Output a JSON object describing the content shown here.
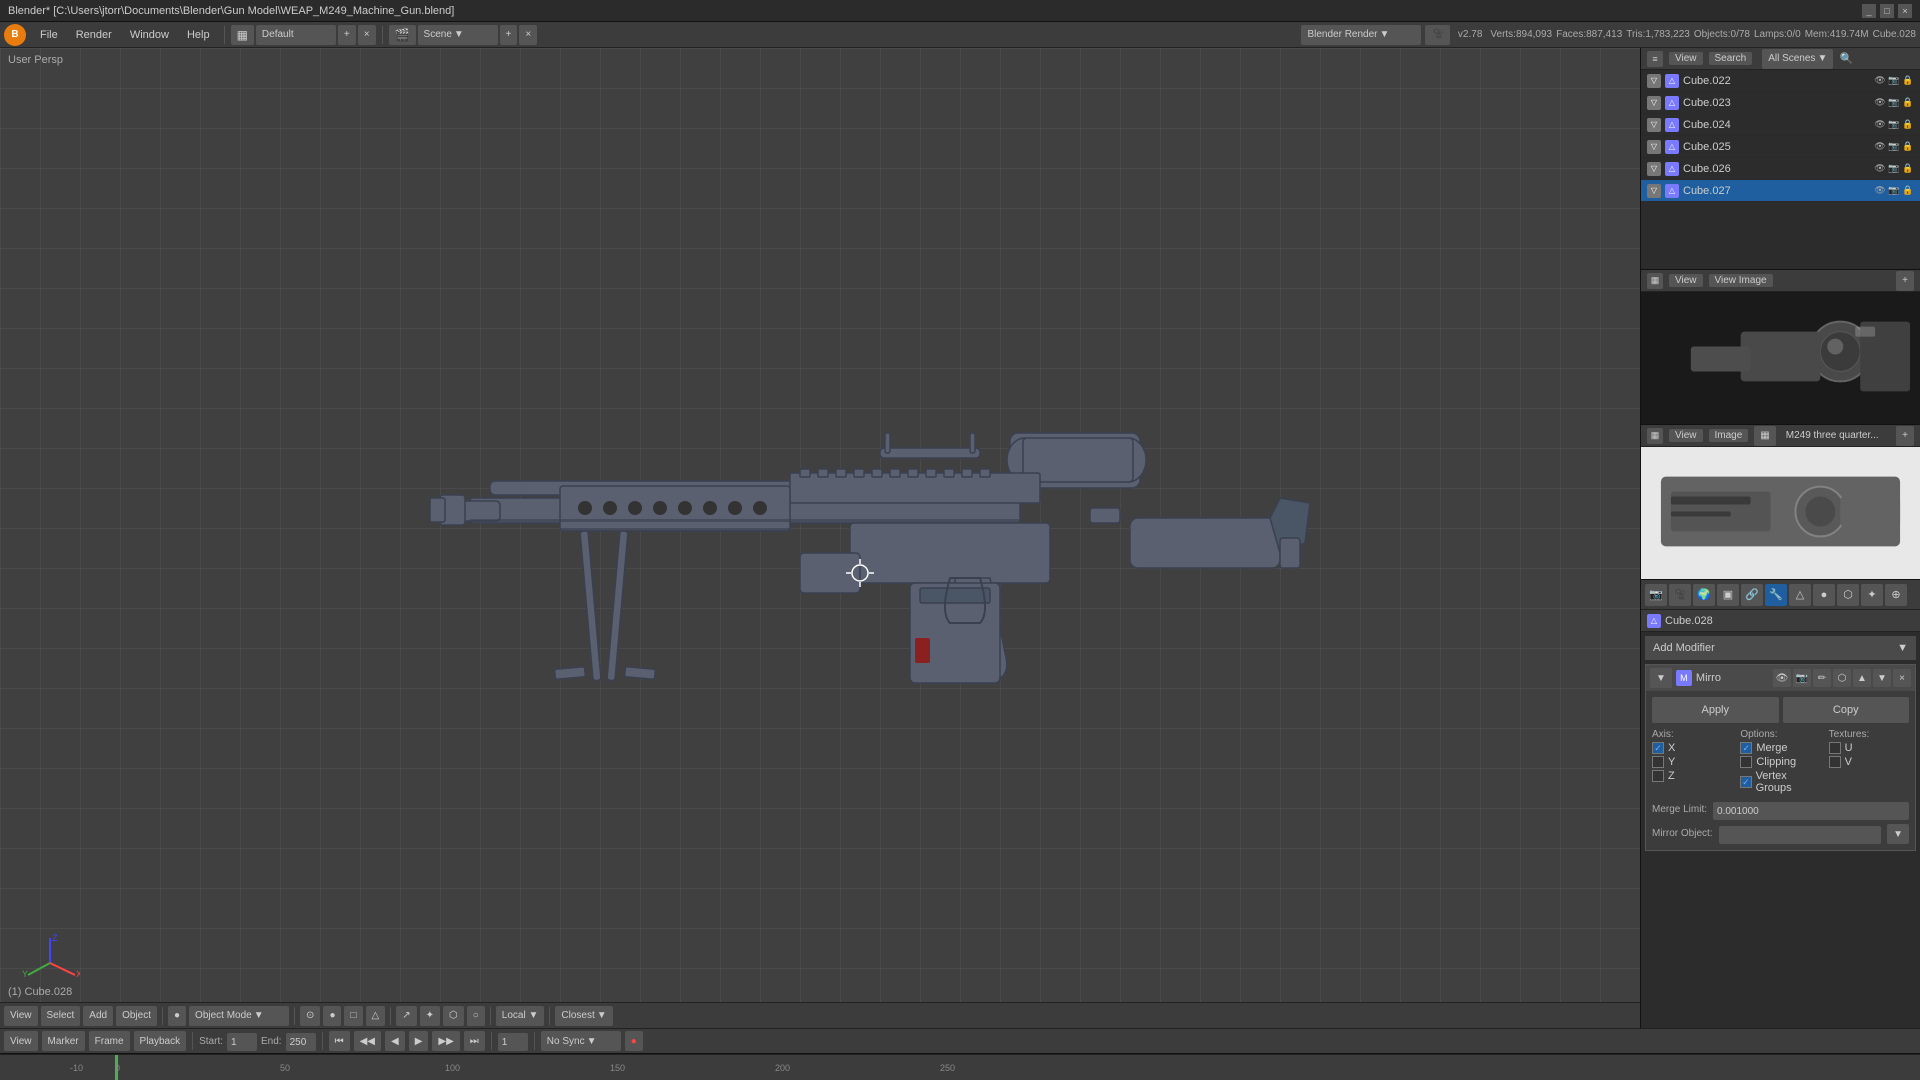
{
  "titleBar": {
    "title": "Blender* [C:\\Users\\jtorr\\Documents\\Blender\\Gun Model\\WEAP_M249_Machine_Gun.blend]",
    "minimizeBtn": "_",
    "maximizeBtn": "□",
    "closeBtn": "×"
  },
  "menuBar": {
    "logo": "B",
    "items": [
      "File",
      "Render",
      "Window",
      "Help"
    ],
    "layoutMode": "Default",
    "sceneLabel": "Scene",
    "renderEngine": "Blender Render",
    "engineArrow": "▼"
  },
  "infoBar": {
    "version": "v2.78",
    "verts": "Verts:894,093",
    "faces": "Faces:887,413",
    "tris": "Tris:1,783,223",
    "objects": "Objects:0/78",
    "lamps": "Lamps:0/0",
    "mem": "Mem:419.74M",
    "activeObj": "Cube.028"
  },
  "viewport": {
    "label": "User Persp",
    "objectLabel": "(1) Cube.028"
  },
  "outliner": {
    "header": {
      "viewBtn": "View",
      "searchBtn": "Search",
      "allScenesLabel": "All Scenes",
      "searchIcon": "🔍"
    },
    "items": [
      {
        "name": "Cube.022",
        "visible": true,
        "selected": false
      },
      {
        "name": "Cube.023",
        "visible": true,
        "selected": false
      },
      {
        "name": "Cube.024",
        "visible": true,
        "selected": false
      },
      {
        "name": "Cube.025",
        "visible": true,
        "selected": false
      },
      {
        "name": "Cube.026",
        "visible": true,
        "selected": false
      },
      {
        "name": "Cube.027",
        "visible": true,
        "selected": true
      }
    ]
  },
  "imagePreview1": {
    "label": "View Image",
    "imgLabel": "M249 three quarter..."
  },
  "propertiesPanel": {
    "activeObject": "Cube.028",
    "icons": [
      "📷",
      "🔵",
      "🔩",
      "⚙",
      "🔧",
      "✦",
      "🔗",
      "📐",
      "🔒",
      "💾"
    ],
    "addModifierBtn": "Add Modifier",
    "modifiers": [
      {
        "name": "Mirro",
        "icon": "M",
        "applyBtn": "Apply",
        "copyBtn": "Copy",
        "axis": {
          "label": "Axis:",
          "x": {
            "label": "X",
            "checked": true
          },
          "y": {
            "label": "Y",
            "checked": false
          },
          "z": {
            "label": "Z",
            "checked": false
          }
        },
        "options": {
          "label": "Options:",
          "merge": {
            "label": "Merge",
            "checked": true
          },
          "clipping": {
            "label": "Clipping",
            "checked": false
          },
          "vertexGroups": {
            "label": "Vertex Groups",
            "checked": true
          }
        },
        "textures": {
          "label": "Textures:",
          "u": {
            "label": "U",
            "checked": false
          },
          "v": {
            "label": "V",
            "checked": false
          }
        },
        "mergeLimit": {
          "label": "Merge Limit:",
          "value": "0.001000"
        },
        "mirrorObject": {
          "label": "Mirror Object:"
        }
      }
    ]
  },
  "bottomToolbar": {
    "view": "View",
    "select": "Select",
    "add": "Add",
    "object": "Object",
    "objectMode": "Object Mode",
    "pivotIcon": "◉",
    "local": "Local",
    "snap": "Closest",
    "icons": [
      "●",
      "□",
      "△",
      "↗",
      "✦",
      "⬡",
      "○",
      "≡"
    ]
  },
  "timeline": {
    "view": "View",
    "marker": "Marker",
    "frame": "Frame",
    "playback": "Playback",
    "startLabel": "Start:",
    "startVal": "1",
    "endLabel": "End:",
    "endVal": "250",
    "currentFrame": "1",
    "syncMode": "No Sync",
    "ticks": [
      "-10",
      "0",
      "50",
      "100",
      "150",
      "200",
      "250"
    ]
  }
}
